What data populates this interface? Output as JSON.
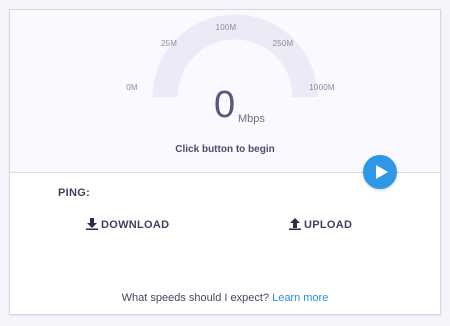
{
  "gauge": {
    "ticks": {
      "t0": "0M",
      "t25": "25M",
      "t100": "100M",
      "t250": "250M",
      "t1000": "1000M"
    },
    "value": "0",
    "unit": "Mbps",
    "prompt": "Click button to begin"
  },
  "controls": {
    "play_icon": "play-icon",
    "accent_color": "#2f97e8"
  },
  "results": {
    "ping_label": "PING:",
    "download_label": "DOWNLOAD",
    "upload_label": "UPLOAD",
    "download_icon": "download-icon",
    "upload_icon": "upload-icon"
  },
  "footer": {
    "question": "What speeds should I expect?",
    "link": "Learn more"
  }
}
